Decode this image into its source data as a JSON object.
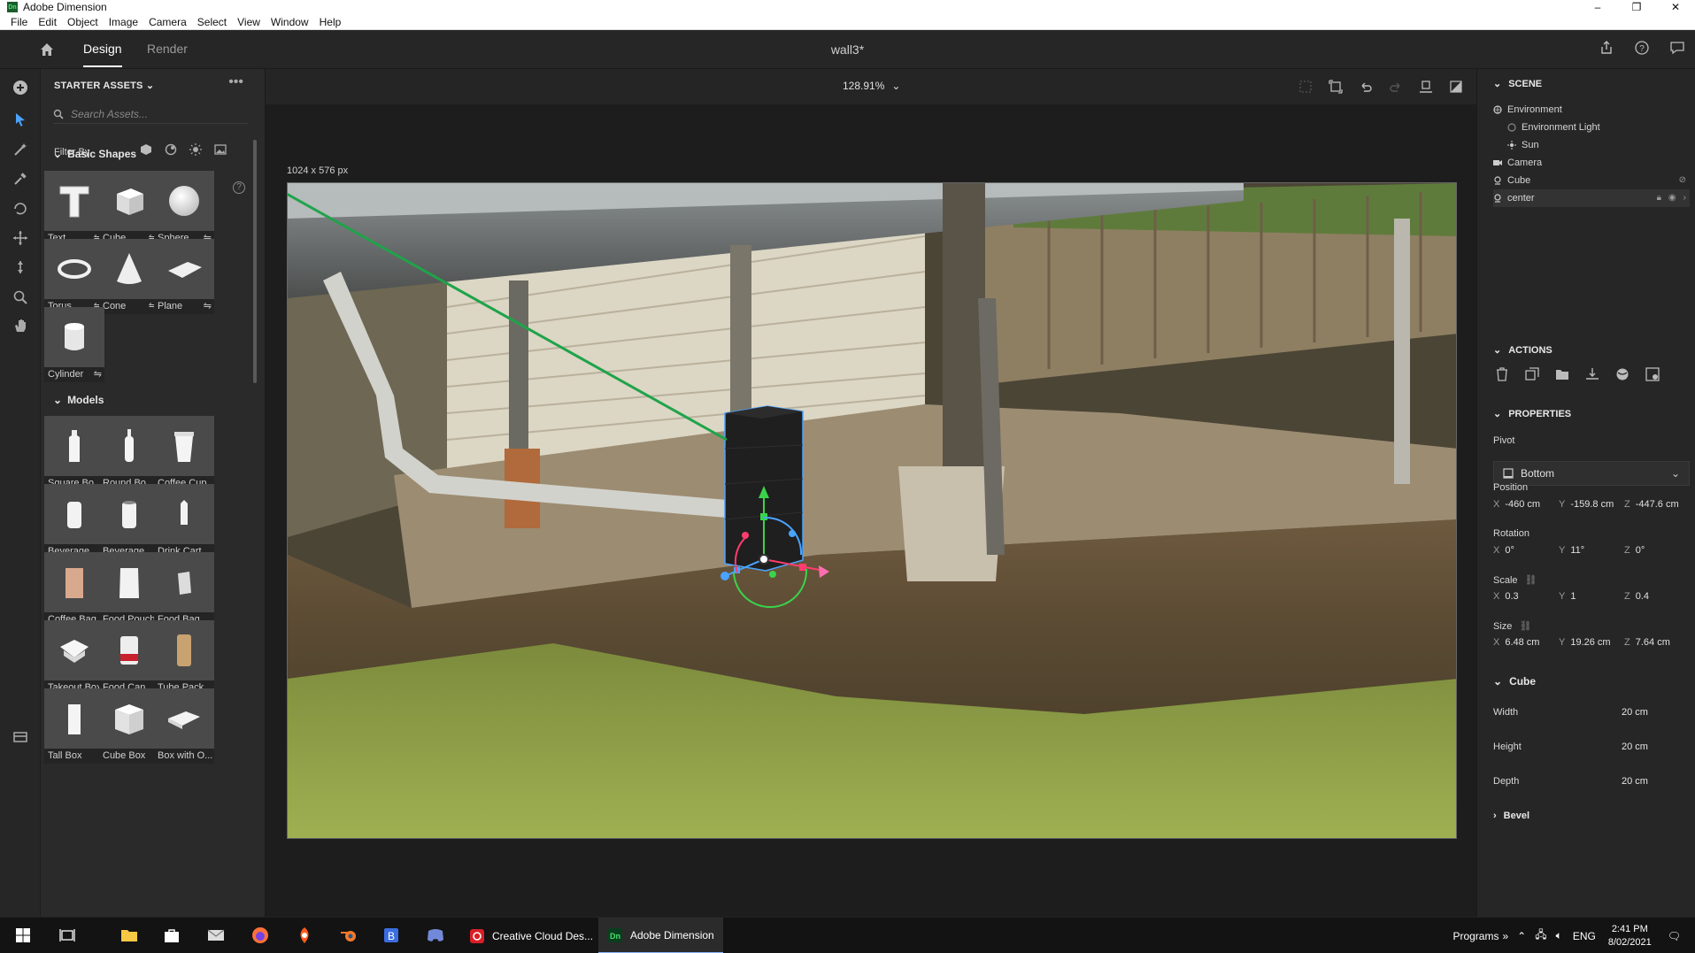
{
  "window": {
    "app_title": "Adobe Dimension",
    "logo_text": "Dn",
    "minimize": "–",
    "maximize": "❐",
    "close": "✕"
  },
  "menu": [
    "File",
    "Edit",
    "Object",
    "Image",
    "Camera",
    "Select",
    "View",
    "Window",
    "Help"
  ],
  "header": {
    "tab_design": "Design",
    "tab_render": "Render",
    "doc_title": "wall3*"
  },
  "assets": {
    "title": "STARTER ASSETS",
    "more": "•••",
    "search_placeholder": "Search Assets...",
    "filter_label": "Filter By",
    "basic_shapes_title": "Basic Shapes",
    "basic_shapes": [
      {
        "label": "Text"
      },
      {
        "label": "Cube"
      },
      {
        "label": "Sphere"
      },
      {
        "label": "Torus"
      },
      {
        "label": "Cone"
      },
      {
        "label": "Plane"
      },
      {
        "label": "Cylinder"
      }
    ],
    "models_title": "Models",
    "models": [
      {
        "label": "Square Bo..."
      },
      {
        "label": "Round Bo..."
      },
      {
        "label": "Coffee Cup"
      },
      {
        "label": "Beverage ..."
      },
      {
        "label": "Beverage ..."
      },
      {
        "label": "Drink Cart..."
      },
      {
        "label": "Coffee Bag"
      },
      {
        "label": "Food Pouch"
      },
      {
        "label": "Food Bag"
      },
      {
        "label": "Takeout Box"
      },
      {
        "label": "Food Can"
      },
      {
        "label": "Tube Pack..."
      },
      {
        "label": "Tall Box"
      },
      {
        "label": "Cube Box"
      },
      {
        "label": "Box with O..."
      }
    ],
    "options_glyph": "⇋",
    "help_glyph": "?"
  },
  "viewport": {
    "zoom": "128.91%",
    "canvas_size": "1024 x 576 px"
  },
  "scene": {
    "title": "SCENE",
    "layers": [
      {
        "label": "Environment",
        "indent": 0
      },
      {
        "label": "Environment Light",
        "indent": 1
      },
      {
        "label": "Sun",
        "indent": 1
      },
      {
        "label": "Camera",
        "indent": 0
      },
      {
        "label": "Cube",
        "indent": 0
      },
      {
        "label": "center",
        "indent": 0
      }
    ]
  },
  "actions": {
    "title": "ACTIONS"
  },
  "properties": {
    "title": "PROPERTIES",
    "pivot_label": "Pivot",
    "pivot_value": "Bottom",
    "position_label": "Position",
    "position": {
      "x": "-460 cm",
      "y": "-159.8 cm",
      "z": "-447.6 cm"
    },
    "rotation_label": "Rotation",
    "rotation": {
      "x": "0°",
      "y": "11°",
      "z": "0°"
    },
    "scale_label": "Scale",
    "scale": {
      "x": "0.3",
      "y": "1",
      "z": "0.4"
    },
    "size_label": "Size",
    "size": {
      "x": "6.48 cm",
      "y": "19.26 cm",
      "z": "7.64 cm"
    },
    "axis_x": "X",
    "axis_y": "Y",
    "axis_z": "Z"
  },
  "cube": {
    "title": "Cube",
    "width_label": "Width",
    "width": "20 cm",
    "height_label": "Height",
    "height": "20 cm",
    "depth_label": "Depth",
    "depth": "20 cm",
    "bevel_label": "Bevel"
  },
  "taskbar": {
    "creative_cloud": "Creative Cloud Des...",
    "dimension": "Adobe Dimension",
    "programs": "Programs",
    "lang": "ENG",
    "time": "2:41 PM",
    "date": "8/02/2021"
  },
  "colors": {
    "accent_blue": "#4aa3ff",
    "green_link": "#1fa34a",
    "gizmo_green": "#3bd34b",
    "gizmo_red": "#ff3c6e",
    "gizmo_blue": "#4aa3ff"
  }
}
